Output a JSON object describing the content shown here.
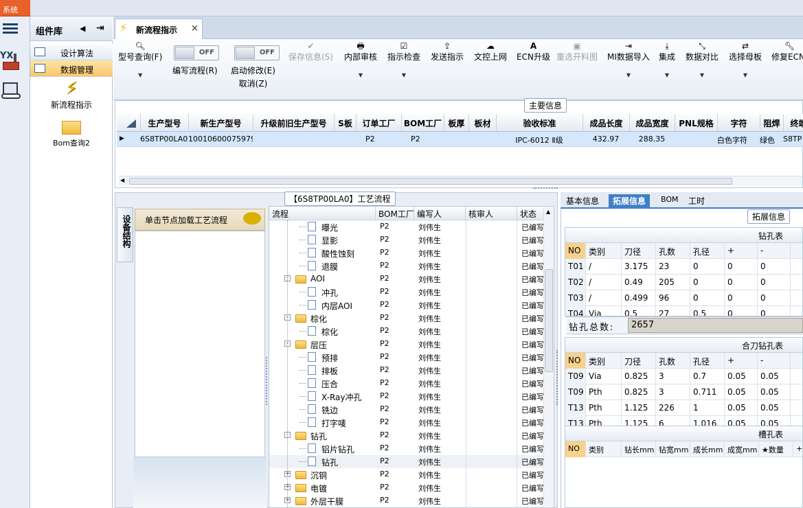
{
  "system_menu": "系统",
  "component_library": {
    "title": "组件库",
    "items": [
      {
        "label": "设计算法"
      },
      {
        "label": "数据管理"
      }
    ],
    "tiles": [
      {
        "label": "新流程指示"
      },
      {
        "label": "Bom查询2"
      }
    ]
  },
  "tab": {
    "title": "新流程指示",
    "close": "×"
  },
  "toolbar": {
    "model_query": "型号查询(F)",
    "edit_flow": "编写流程(R)",
    "start_modify_1": "启动修改(E)",
    "start_modify_2": "取消(Z)",
    "toggle_off": "OFF",
    "save_info": "保存信息(S)",
    "internal_review": "内部审核",
    "instruction_check": "指示检查",
    "send_instruction": "发送指示",
    "doc_upload": "文控上网",
    "ecn_upgrade": "ECN升级",
    "reopen_drawing": "重选开料图",
    "mi_import": "MI数据导入",
    "integrate": "集成",
    "data_compare": "数据对比",
    "select_motherboard": "选择母板",
    "repair_ecn": "修复ECN-"
  },
  "main_info": {
    "title": "主要信息",
    "columns": [
      "生产型号",
      "新生产型号",
      "升级前旧生产型号",
      "S板",
      "订单工厂",
      "BOM工厂",
      "板厚",
      "板材",
      "验收标准",
      "成品长度",
      "成品宽度",
      "PNL规格",
      "字符",
      "阻焊",
      "终端客"
    ],
    "row": [
      "6S8TP00LA0",
      "10010600075979",
      "",
      "",
      "P2",
      "P2",
      "",
      "",
      "IPC-6012 Ⅱ级",
      "432.97",
      "288.35",
      "",
      "白色字符",
      "绿色",
      "S8TP"
    ]
  },
  "device_structure": {
    "tab_label": "设备结构",
    "hint": "单击节点加载工艺流程"
  },
  "process_flow": {
    "title": "【6S8TP00LA0】工艺流程",
    "columns": [
      "流程",
      "BOM工厂",
      "编写人",
      "核审人",
      "状态"
    ],
    "rows": [
      {
        "name": "曝光",
        "bom": "P2",
        "writer": "刘伟生",
        "status": "已编写",
        "kind": "file",
        "level": 2
      },
      {
        "name": "显影",
        "bom": "P2",
        "writer": "刘伟生",
        "status": "已编写",
        "kind": "file",
        "level": 2
      },
      {
        "name": "酸性蚀刻",
        "bom": "P2",
        "writer": "刘伟生",
        "status": "已编写",
        "kind": "file",
        "level": 2
      },
      {
        "name": "退膜",
        "bom": "P2",
        "writer": "刘伟生",
        "status": "已编写",
        "kind": "file",
        "level": 2
      },
      {
        "name": "AOI",
        "bom": "P2",
        "writer": "刘伟生",
        "status": "已编写",
        "kind": "folder",
        "level": 1,
        "exp": "-"
      },
      {
        "name": "冲孔",
        "bom": "P2",
        "writer": "刘伟生",
        "status": "已编写",
        "kind": "file",
        "level": 2
      },
      {
        "name": "内层AOI",
        "bom": "P2",
        "writer": "刘伟生",
        "status": "已编写",
        "kind": "file",
        "level": 2
      },
      {
        "name": "棕化",
        "bom": "P2",
        "writer": "刘伟生",
        "status": "已编写",
        "kind": "folder",
        "level": 1,
        "exp": "-"
      },
      {
        "name": "棕化",
        "bom": "P2",
        "writer": "刘伟生",
        "status": "已编写",
        "kind": "file",
        "level": 2
      },
      {
        "name": "层压",
        "bom": "P2",
        "writer": "刘伟生",
        "status": "已编写",
        "kind": "folder",
        "level": 1,
        "exp": "-"
      },
      {
        "name": "预排",
        "bom": "P2",
        "writer": "刘伟生",
        "status": "已编写",
        "kind": "file",
        "level": 2
      },
      {
        "name": "排板",
        "bom": "P2",
        "writer": "刘伟生",
        "status": "已编写",
        "kind": "file",
        "level": 2
      },
      {
        "name": "压合",
        "bom": "P2",
        "writer": "刘伟生",
        "status": "已编写",
        "kind": "file",
        "level": 2
      },
      {
        "name": "X-Ray冲孔",
        "bom": "P2",
        "writer": "刘伟生",
        "status": "已编写",
        "kind": "file",
        "level": 2
      },
      {
        "name": "铣边",
        "bom": "P2",
        "writer": "刘伟生",
        "status": "已编写",
        "kind": "file",
        "level": 2
      },
      {
        "name": "打字唛",
        "bom": "P2",
        "writer": "刘伟生",
        "status": "已编写",
        "kind": "file",
        "level": 2
      },
      {
        "name": "钻孔",
        "bom": "P2",
        "writer": "刘伟生",
        "status": "已编写",
        "kind": "folder",
        "level": 1,
        "exp": "-"
      },
      {
        "name": "铝片钻孔",
        "bom": "P2",
        "writer": "刘伟生",
        "status": "已编写",
        "kind": "file",
        "level": 2
      },
      {
        "name": "钻孔",
        "bom": "P2",
        "writer": "刘伟生",
        "status": "已编写",
        "kind": "file",
        "level": 2,
        "selected": true
      },
      {
        "name": "沉铜",
        "bom": "P2",
        "writer": "刘伟生",
        "status": "已编写",
        "kind": "folder",
        "level": 1,
        "exp": "+"
      },
      {
        "name": "电镀",
        "bom": "P2",
        "writer": "刘伟生",
        "status": "已编写",
        "kind": "folder",
        "level": 1,
        "exp": "+"
      },
      {
        "name": "外层干膜",
        "bom": "P2",
        "writer": "刘伟生",
        "status": "已编写",
        "kind": "folder",
        "level": 1,
        "exp": "+"
      }
    ]
  },
  "right_tabs": [
    {
      "label": "基本信息"
    },
    {
      "label": "拓展信息"
    },
    {
      "label": "BOM"
    },
    {
      "label": "工时"
    }
  ],
  "extend_info": {
    "title": "拓展信息",
    "drill_table": {
      "title": "钻孔表",
      "columns": [
        "NO",
        "类别",
        "刀径",
        "孔数",
        "孔径",
        "+",
        "-"
      ],
      "rows": [
        [
          "T01",
          "/",
          "3.175",
          "23",
          "0",
          "0",
          "0"
        ],
        [
          "T02",
          "/",
          "0.49",
          "205",
          "0",
          "0",
          "0"
        ],
        [
          "T03",
          "/",
          "0.499",
          "96",
          "0",
          "0",
          "0"
        ],
        [
          "T04",
          "Via",
          "0.5",
          "27",
          "0.5",
          "0",
          "0"
        ]
      ]
    },
    "hole_total_label": "钻孔总数:",
    "hole_total": "2657",
    "combo_table": {
      "title": "合刀钻孔表",
      "columns": [
        "NO",
        "类别",
        "刀径",
        "孔数",
        "孔径",
        "+",
        "-"
      ],
      "rows": [
        [
          "T09",
          "Via",
          "0.825",
          "3",
          "0.7",
          "0.05",
          "0.05"
        ],
        [
          "T09",
          "Pth",
          "0.825",
          "3",
          "0.711",
          "0.05",
          "0.05"
        ],
        [
          "T13",
          "Pth",
          "1.125",
          "226",
          "1",
          "0.05",
          "0.05"
        ],
        [
          "T13",
          "Pth",
          "1.125",
          "6",
          "1.016",
          "0.05",
          "0.05"
        ]
      ]
    },
    "slot_table": {
      "title": "槽孔表",
      "columns": [
        "NO",
        "类别",
        "钻长mm",
        "钻宽mm",
        "成长mm",
        "成宽mm",
        "★数量",
        "+"
      ]
    }
  }
}
